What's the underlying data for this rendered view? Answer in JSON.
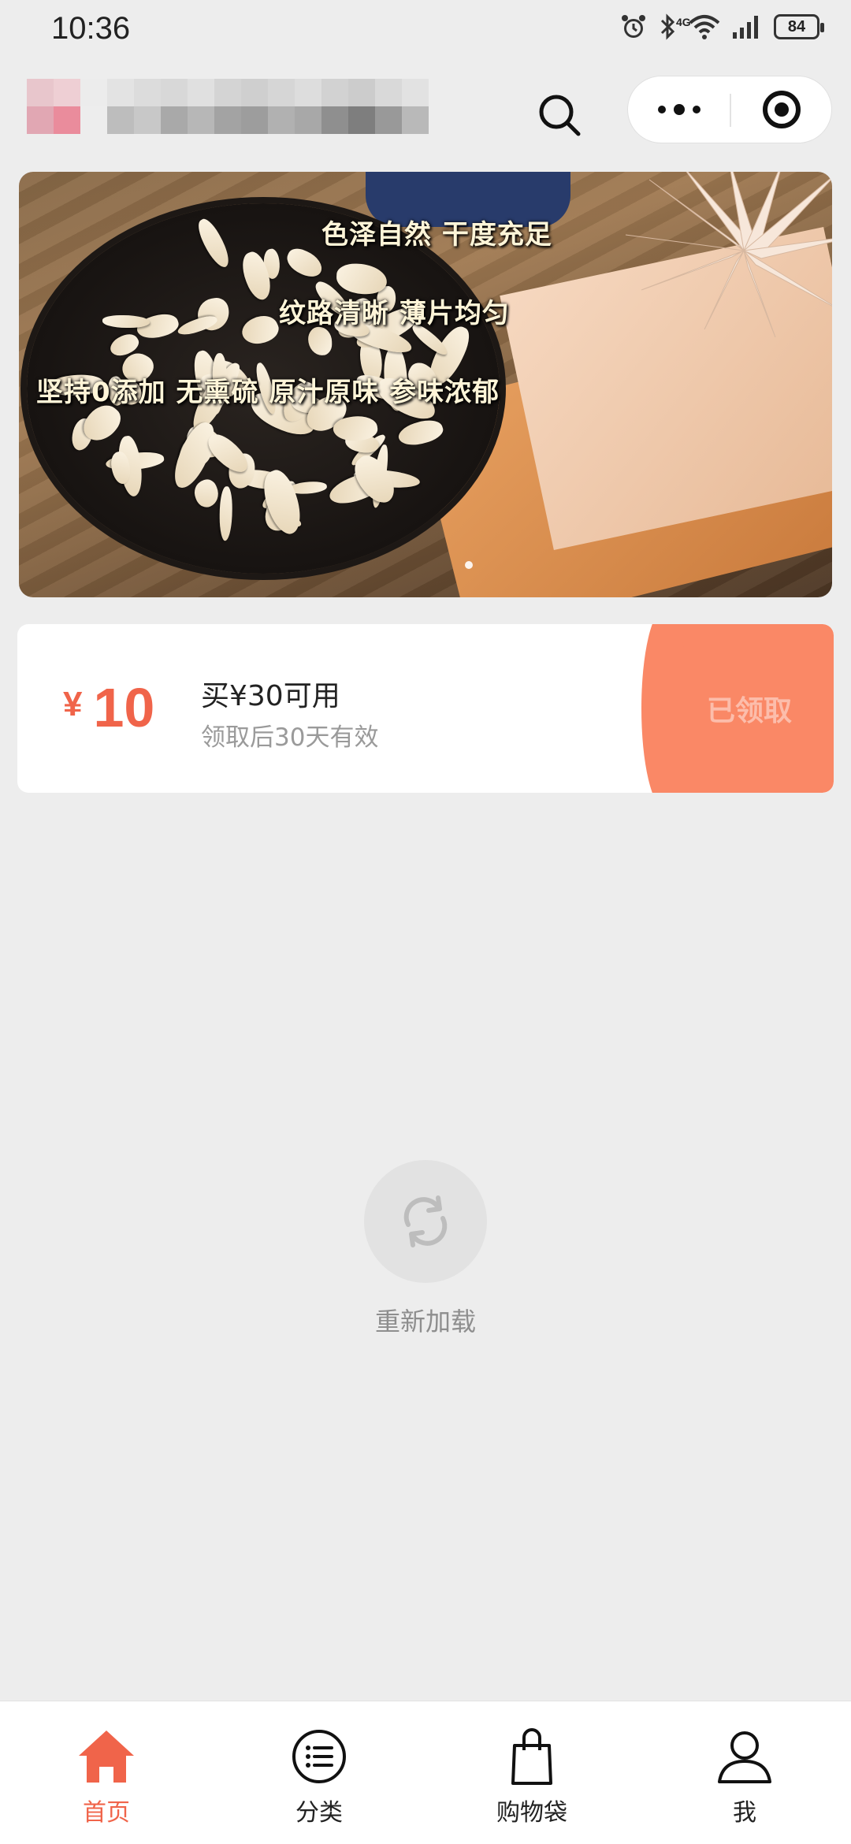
{
  "status_bar": {
    "time": "10:36",
    "network": "4G",
    "battery": "84"
  },
  "header": {
    "brand_name": "",
    "search_icon": "search-icon",
    "more_icon": "more-dots-icon",
    "close_icon": "target-close-icon"
  },
  "banner": {
    "captions": [
      "色泽自然 干度充足",
      "纹路清晰 薄片均匀",
      "坚持0添加 无熏硫 原汁原味 参味浓郁"
    ],
    "active_slide": 1
  },
  "coupon": {
    "currency": "¥",
    "amount": "10",
    "condition": "买¥30可用",
    "validity": "领取后30天有效",
    "claim_label": "已领取",
    "accent_color": "#f0644a",
    "claim_color": "#fa8866"
  },
  "reload": {
    "icon": "refresh-icon",
    "label": "重新加载"
  },
  "tabbar": {
    "active_color": "#f0644a",
    "items": [
      {
        "label": "首页",
        "icon": "home-icon"
      },
      {
        "label": "分类",
        "icon": "list-icon"
      },
      {
        "label": "购物袋",
        "icon": "shopping-bag-icon"
      },
      {
        "label": "我",
        "icon": "person-icon"
      }
    ]
  }
}
